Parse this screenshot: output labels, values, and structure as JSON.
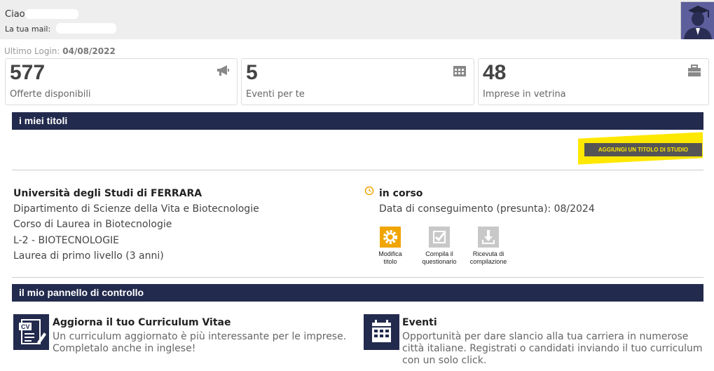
{
  "header": {
    "greeting": "Ciao",
    "mail_label": "La tua mail:"
  },
  "last_login": {
    "label": "Ultimo Login:",
    "date": "04/08/2022"
  },
  "stats": [
    {
      "value": "577",
      "label": "Offerte disponibili",
      "icon": "megaphone-icon"
    },
    {
      "value": "5",
      "label": "Eventi per te",
      "icon": "calendar-icon"
    },
    {
      "value": "48",
      "label": "Imprese in vetrina",
      "icon": "briefcase-icon"
    }
  ],
  "titoli": {
    "heading": "i miei titoli",
    "add_button": "AGGIUNGI UN TITOLO DI STUDIO",
    "degree": {
      "university": "Università degli Studi di FERRARA",
      "department": "Dipartimento di Scienze della Vita e Biotecnologie",
      "course": "Corso di Laurea in Biotecnologie",
      "class": "L-2 - BIOTECNOLOGIE",
      "level": "Laurea di primo livello (3 anni)",
      "status": "in corso",
      "graduation": "Data di conseguimento (presunta): 08/2024"
    },
    "actions": [
      {
        "line1": "Modifica",
        "line2": "titolo",
        "icon": "gear-icon"
      },
      {
        "line1": "Compila il",
        "line2": "questionario",
        "icon": "checkbox-icon"
      },
      {
        "line1": "Ricevuta di",
        "line2": "compilazione",
        "icon": "download-icon"
      }
    ]
  },
  "pannello": {
    "heading": "il mio pannello di controllo",
    "cv": {
      "title": "Aggiorna il tuo Curriculum Vitae",
      "desc1": "Un curriculum aggiornato è più interessante per le imprese.",
      "desc2": "Completalo anche in inglese!",
      "icon": "cv-icon"
    },
    "eventi": {
      "title": "Eventi",
      "desc1": "Opportunità per dare slancio alla tua carriera in numerose",
      "desc2": "città italiane. Registrati o candidati inviando il tuo curriculum",
      "desc3": "con un solo click.",
      "icon": "calendar-icon"
    }
  },
  "colors": {
    "navy": "#222a4d",
    "highlight": "#ffe800",
    "button": "#555555",
    "accent": "#f0a500"
  }
}
